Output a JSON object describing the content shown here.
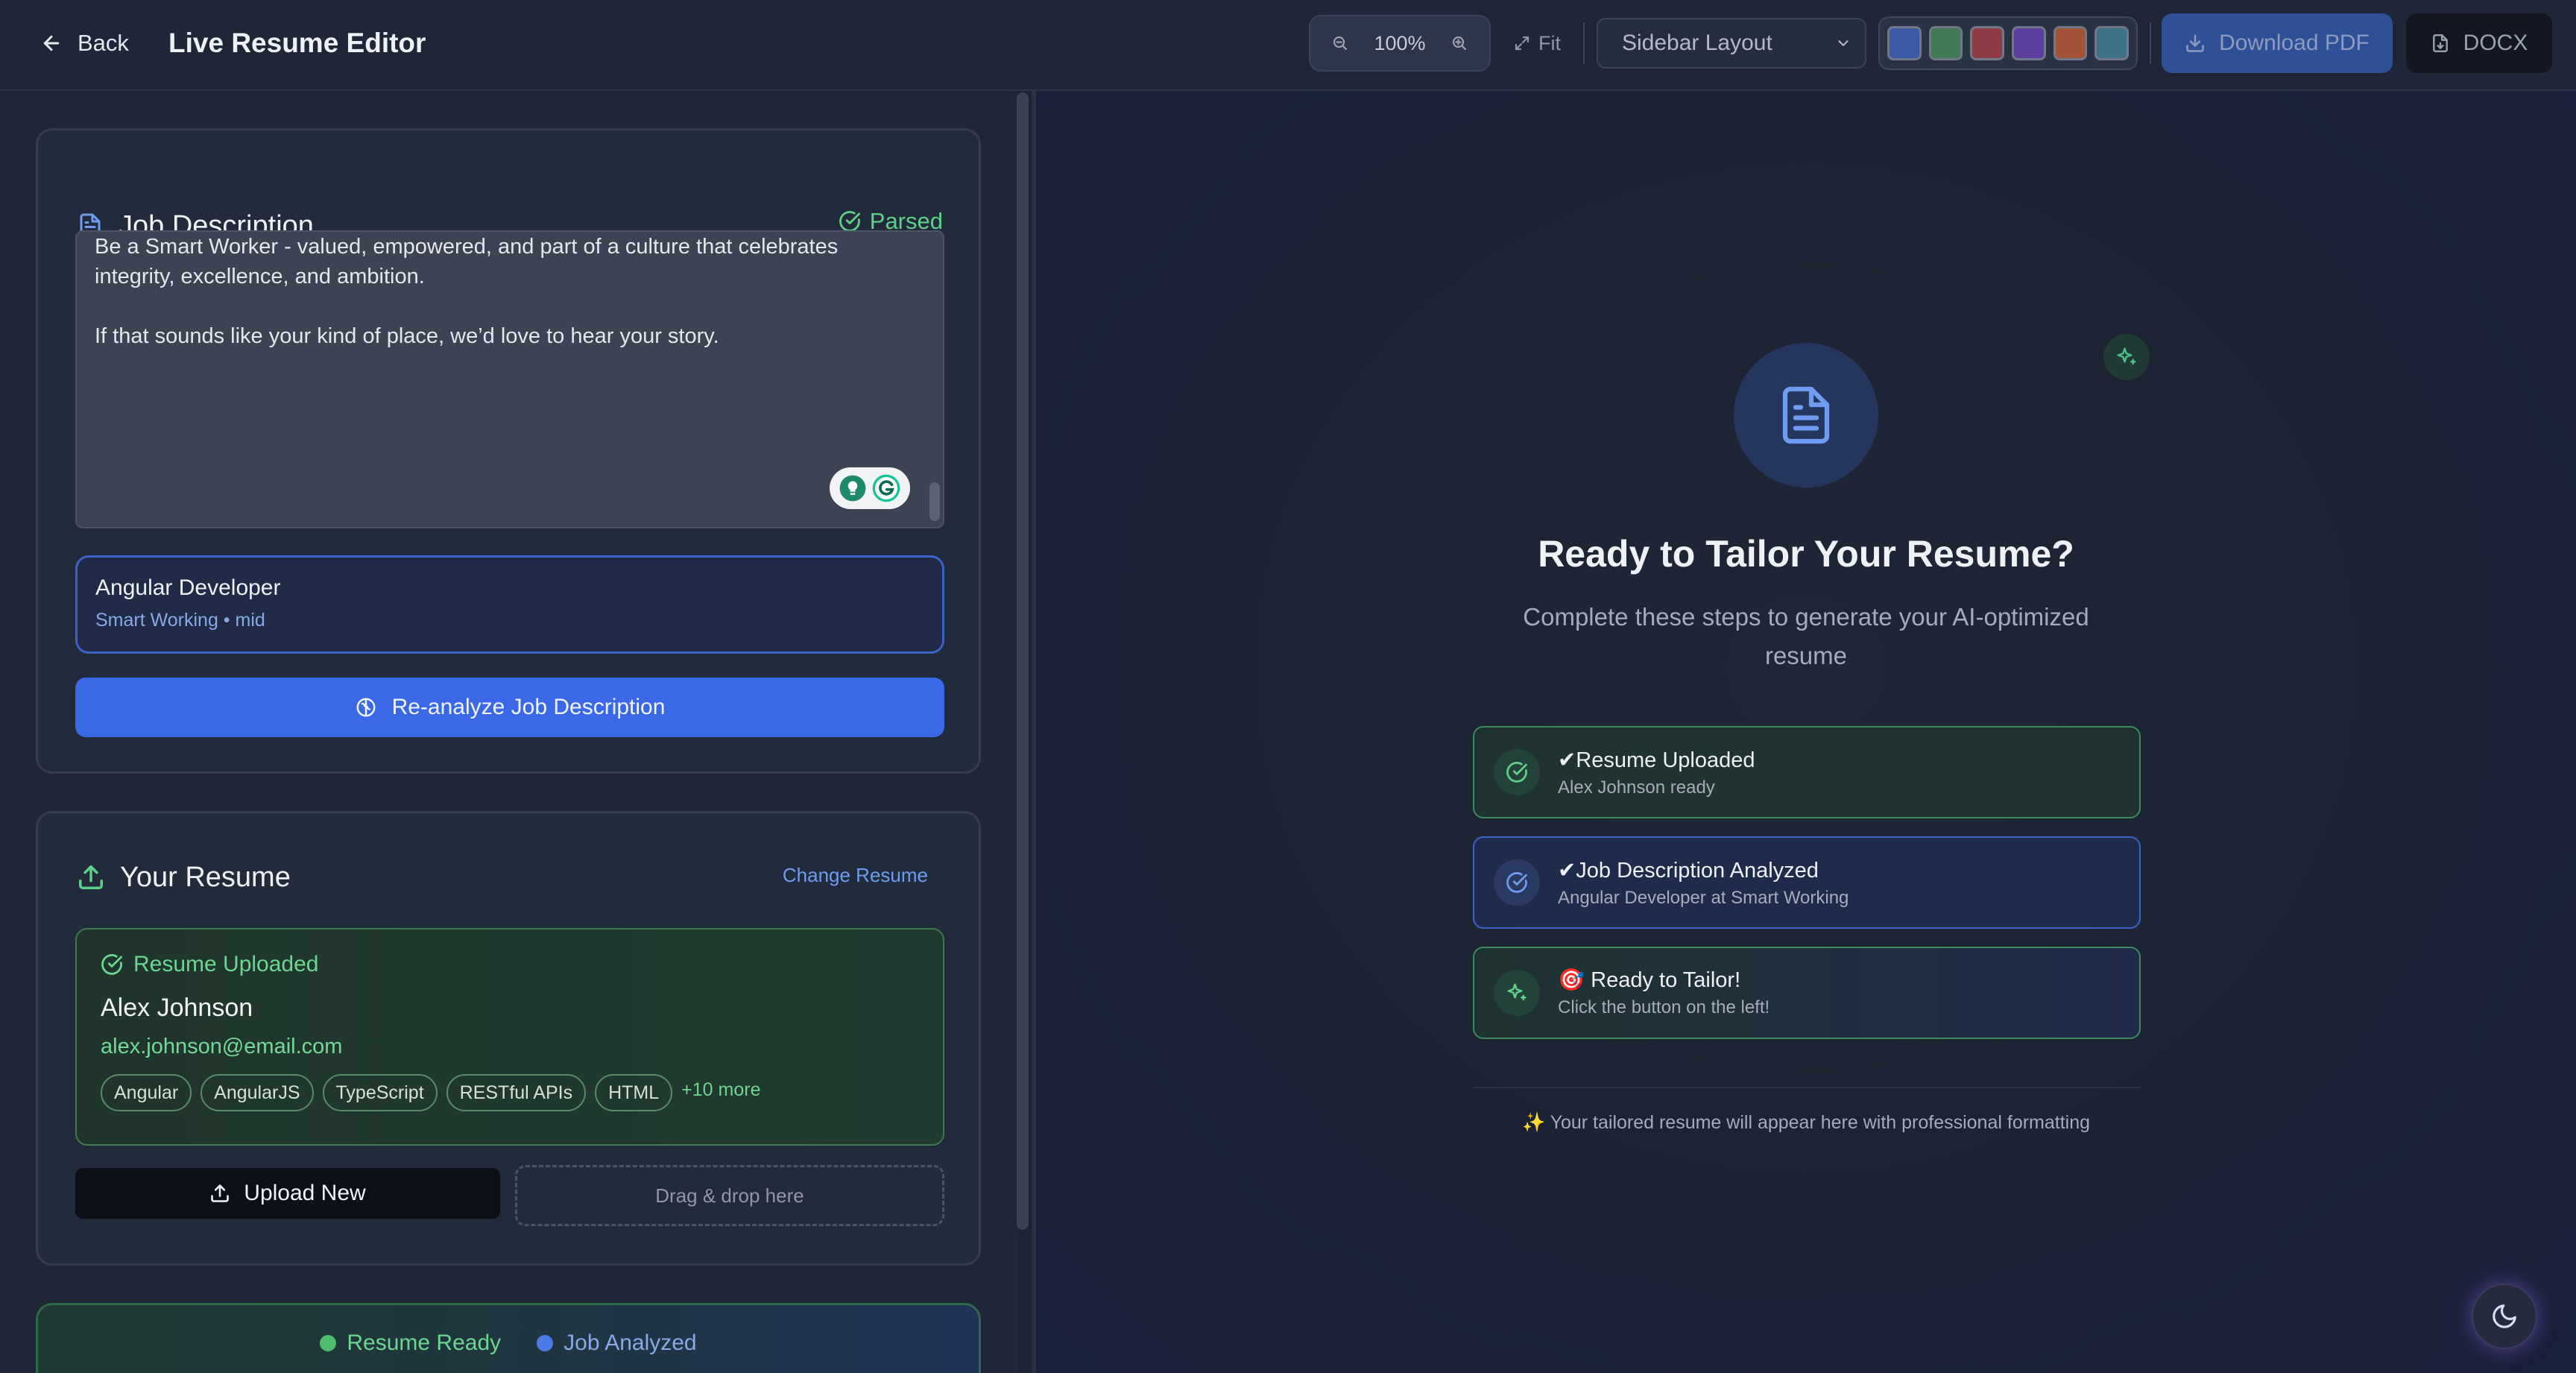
{
  "header": {
    "back_label": "Back",
    "title": "Live Resume Editor",
    "zoom_value": "100%",
    "fit_label": "Fit",
    "layout_select": "Sidebar Layout",
    "color_swatches": [
      "#3a5aa6",
      "#3f7a54",
      "#8f3b44",
      "#5d3fa0",
      "#a25337",
      "#3c7188"
    ],
    "download_pdf_label": "Download PDF",
    "docx_label": "DOCX"
  },
  "job_description": {
    "title": "Job Description",
    "status": "Parsed",
    "text": "Be a Smart Worker - valued, empowered, and part of a culture that celebrates integrity, excellence, and ambition.\n\nIf that sounds like your kind of place, we’d love to hear your story.",
    "job_title": "Angular Developer",
    "job_meta": "Smart Working • mid",
    "reanalyze_label": "Re-analyze Job Description"
  },
  "resume": {
    "title": "Your Resume",
    "change_label": "Change Resume",
    "status": "Resume Uploaded",
    "name": "Alex Johnson",
    "email": "alex.johnson@email.com",
    "skills": [
      "Angular",
      "AngularJS",
      "TypeScript",
      "RESTful APIs",
      "HTML"
    ],
    "more_skills": "+10 more",
    "upload_label": "Upload New",
    "drop_label": "Drag & drop here"
  },
  "status_bar": {
    "resume_ready": "Resume Ready",
    "job_analyzed": "Job Analyzed"
  },
  "preview": {
    "title": "Ready to Tailor Your Resume?",
    "subtitle": "Complete these steps to generate your AI-optimized resume",
    "steps": [
      {
        "title": "✔Resume Uploaded",
        "desc": "Alex Johnson ready"
      },
      {
        "title": "✔Job Description Analyzed",
        "desc": "Angular Developer at Smart Working"
      },
      {
        "title": "🎯 Ready to Tailor!",
        "desc": "Click the button on the left!"
      }
    ],
    "footnote": "✨ Your tailored resume will appear here with professional formatting"
  }
}
